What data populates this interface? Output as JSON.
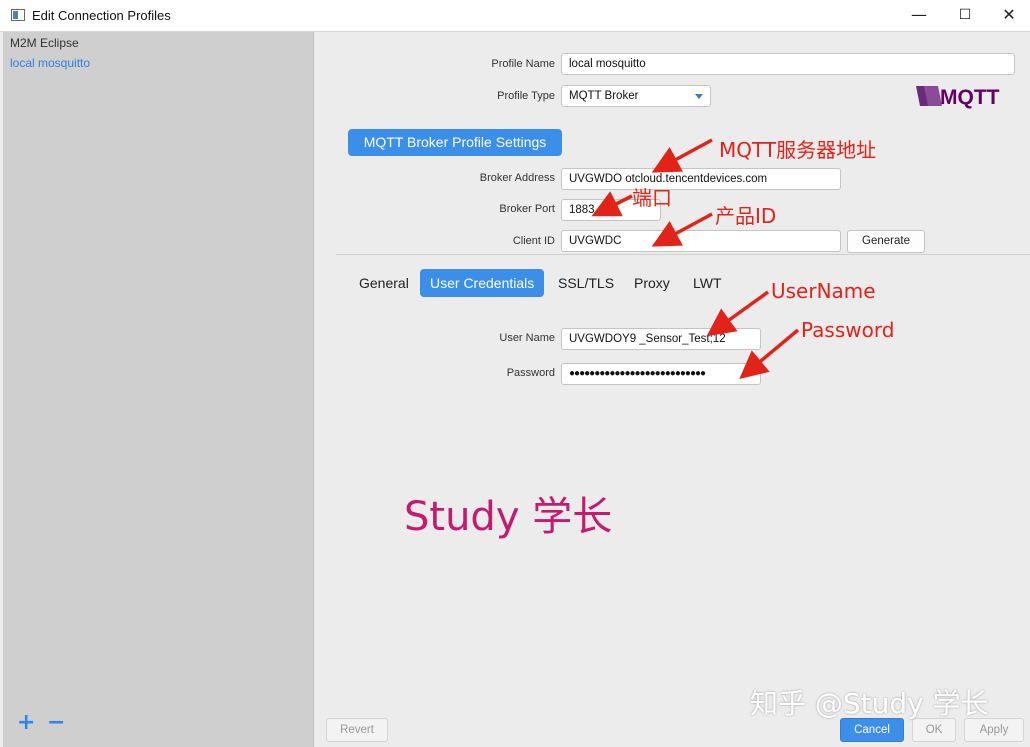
{
  "window": {
    "title": "Edit Connection Profiles"
  },
  "sidebar": {
    "profiles": [
      {
        "label": "M2M Eclipse"
      },
      {
        "label": "local mosquitto"
      }
    ],
    "add_label": "+",
    "remove_label": "−"
  },
  "form": {
    "profile_name": {
      "label": "Profile Name",
      "value": "local mosquitto"
    },
    "profile_type": {
      "label": "Profile Type",
      "value": "MQTT Broker"
    },
    "logo_text": "MQTT",
    "section_title": "MQTT Broker Profile Settings",
    "broker_address": {
      "label": "Broker Address",
      "value": "UVGWDO       otcloud.tencentdevices.com"
    },
    "broker_port": {
      "label": "Broker Port",
      "value": "1883"
    },
    "client_id": {
      "label": "Client ID",
      "value": "UVGWDC"
    },
    "generate_label": "Generate"
  },
  "tabs": [
    {
      "label": "General",
      "active": false
    },
    {
      "label": "User Credentials",
      "active": true
    },
    {
      "label": "SSL/TLS",
      "active": false
    },
    {
      "label": "Proxy",
      "active": false
    },
    {
      "label": "LWT",
      "active": false
    }
  ],
  "credentials": {
    "user_name": {
      "label": "User Name",
      "value": "UVGWDOY9       _Sensor_Test;12"
    },
    "password": {
      "label": "Password",
      "value": "●●●●●●●●●●●●●●●●●●●●●●●●●●●"
    }
  },
  "annotations": {
    "broker_address": "MQTT服务器地址",
    "port": "端口",
    "product_id": "产品ID",
    "username": "UserName",
    "password": "Password",
    "watermark": "Study 学长",
    "zhihu": "知乎 @Study 学长"
  },
  "buttons": {
    "revert": "Revert",
    "cancel": "Cancel",
    "ok": "OK",
    "apply": "Apply"
  },
  "colors": {
    "accent": "#3b8fe8",
    "annotation": "#e2231a",
    "watermark": "#c41b6e"
  }
}
